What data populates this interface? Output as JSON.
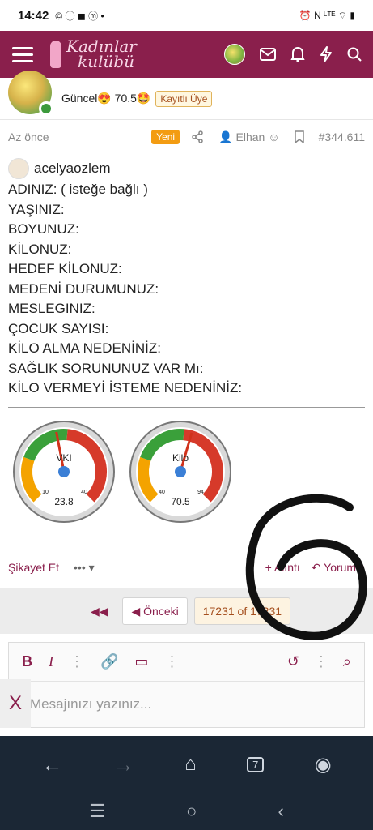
{
  "status": {
    "time": "14:42",
    "icons": "© ⓘ ◼ ⓜ •",
    "right": "⏰ N ᴸᵀᴱ ⌔ ▮"
  },
  "appbar": {
    "logo_line1": "Kadınlar",
    "logo_line2": "kulübü"
  },
  "user": {
    "status_text": "Güncel😍 70.5🤩",
    "badge": "Kayıtlı Üye"
  },
  "meta": {
    "time": "Az önce",
    "new": "Yeni",
    "author": "Elhan",
    "post_no": "#344.611"
  },
  "post": {
    "author": "acelyaozlem",
    "lines": [
      "ADINIZ: ( isteğe bağlı )",
      "YAŞINIZ:",
      "BOYUNUZ:",
      "KİLONUZ:",
      "HEDEF KİLONUZ:",
      "MEDENİ DURUMUNUZ:",
      "MESLEGINIZ:",
      "ÇOCUK SAYISI:",
      "KİLO ALMA NEDENİNİZ:",
      "SAĞLIK SORUNUNUZ VAR Mı:",
      "KİLO VERMEYİ İSTEME NEDENİNİZ:"
    ]
  },
  "gauges": [
    {
      "label": "VKI",
      "min": "10",
      "max": "40",
      "value": "23.8",
      "fraction": 0.46
    },
    {
      "label": "Kilo",
      "min": "40",
      "max": "94",
      "value": "70.5",
      "fraction": 0.56
    }
  ],
  "postfoot": {
    "report": "Şikayet Et",
    "more": "••• ▾",
    "quote": "+ Alıntı",
    "reply": "Yorumla"
  },
  "pager": {
    "first": "◀◀",
    "prev": "◀  Önceki",
    "page": "17231 of 17231"
  },
  "editor": {
    "placeholder": "Mesajınızı yazınız...",
    "close": "X"
  }
}
